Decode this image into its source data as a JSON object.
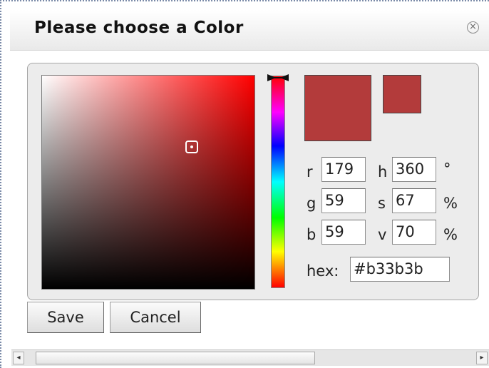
{
  "dialog": {
    "title": "Please choose a Color",
    "close_icon": "close-circle-icon"
  },
  "color": {
    "current_hex": "#b33b3b",
    "original_hex": "#b33b3b",
    "pure_hue_hex": "#ff0000"
  },
  "fields": {
    "r": {
      "label": "r",
      "value": "179"
    },
    "g": {
      "label": "g",
      "value": "59"
    },
    "b": {
      "label": "b",
      "value": "59"
    },
    "h": {
      "label": "h",
      "value": "360",
      "unit": "°"
    },
    "s": {
      "label": "s",
      "value": "67",
      "unit": "%"
    },
    "v": {
      "label": "v",
      "value": "70",
      "unit": "%"
    },
    "hex": {
      "label": "hex:",
      "value": "#b33b3b"
    }
  },
  "buttons": {
    "save": "Save",
    "cancel": "Cancel"
  },
  "scrollbar": {
    "left_arrow_icon": "arrow-left-icon",
    "right_arrow_icon": "arrow-right-icon",
    "left_glyph": "◂",
    "right_glyph": "▸"
  }
}
